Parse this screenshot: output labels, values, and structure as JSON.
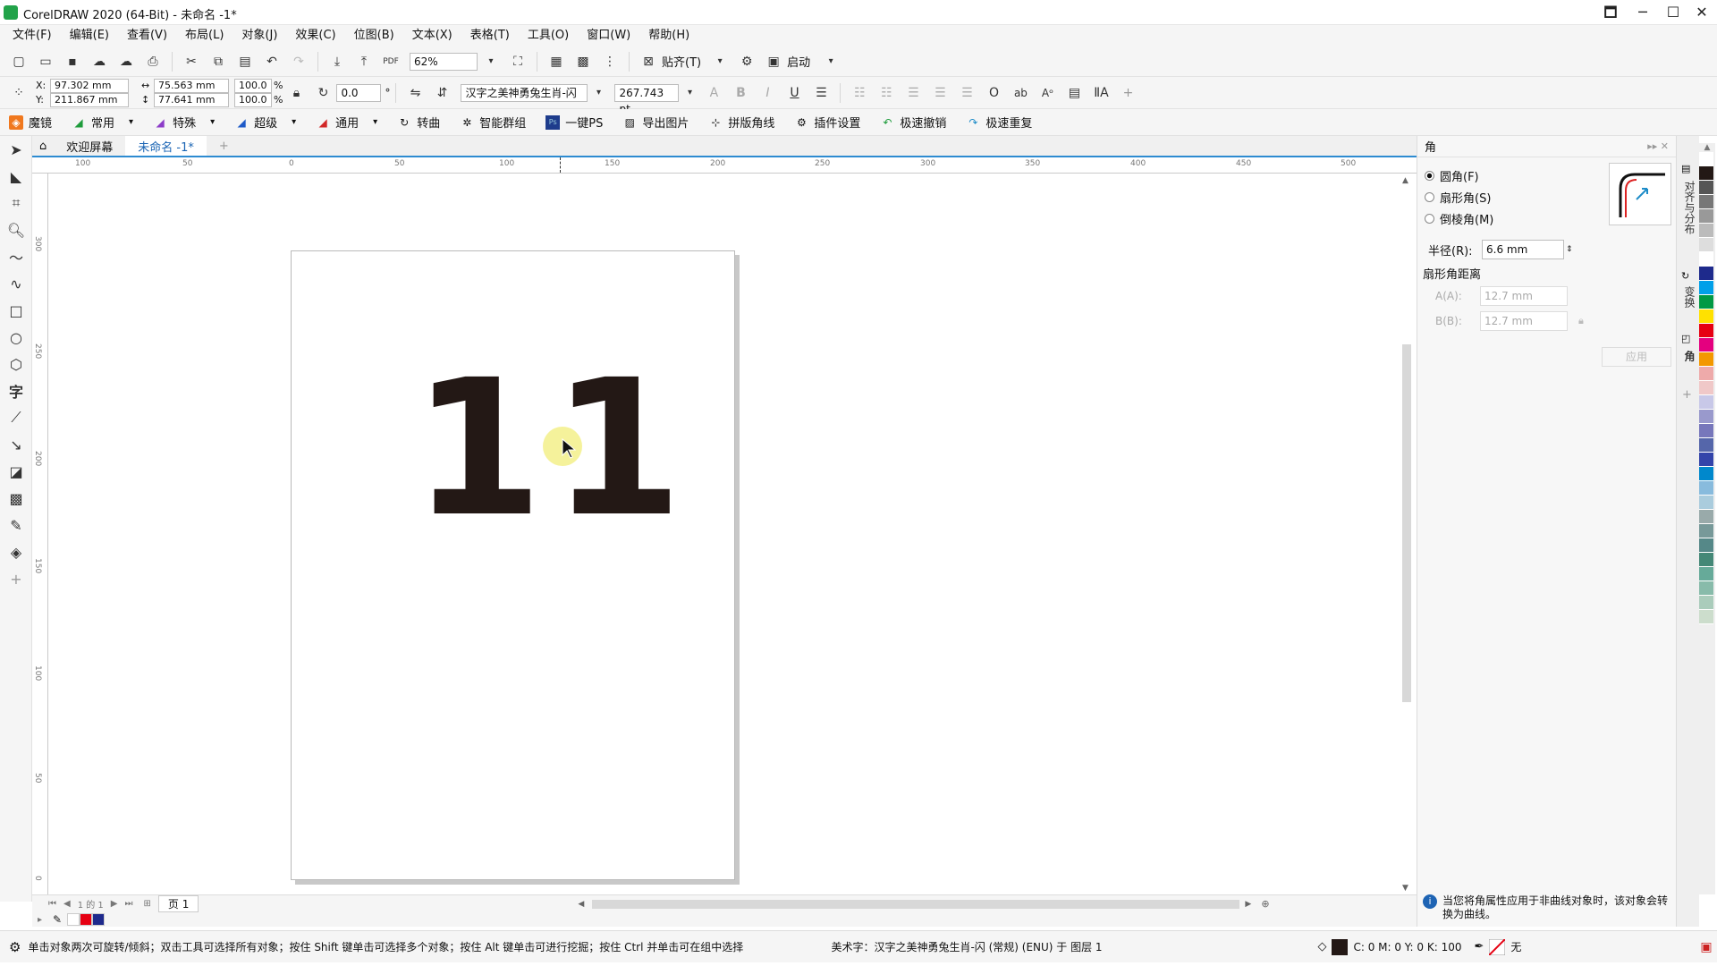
{
  "window": {
    "title": "CorelDRAW 2020 (64-Bit) - 未命名 -1*",
    "controls": [
      "🗖",
      "─",
      "☐",
      "✕"
    ]
  },
  "menu": [
    "文件(F)",
    "编辑(E)",
    "查看(V)",
    "布局(L)",
    "对象(J)",
    "效果(C)",
    "位图(B)",
    "文本(X)",
    "表格(T)",
    "工具(O)",
    "窗口(W)",
    "帮助(H)"
  ],
  "standard_toolbar": {
    "zoom": "62%",
    "snap_label": "贴齐(T)",
    "launch_label": "启动"
  },
  "property_bar": {
    "x": "97.302 mm",
    "y": "211.867 mm",
    "width": "75.563 mm",
    "height": "77.641 mm",
    "scale_x": "100.0",
    "scale_y": "100.0",
    "percent": "%",
    "rotation": "0.0",
    "degree": "°",
    "font_name": "汉字之美神勇兔生肖-闪",
    "font_size": "267.743 pt",
    "bold": "B",
    "italic": "I",
    "underline": "U"
  },
  "plugin_toolbar": [
    "魔镜",
    "常用",
    "特殊",
    "超级",
    "通用",
    "转曲",
    "智能群组",
    "一键PS",
    "导出图片",
    "拼版角线",
    "插件设置",
    "极速撤销",
    "极速重复"
  ],
  "doc_tabs": {
    "welcome": "欢迎屏幕",
    "active": "未命名 -1*",
    "add": "+"
  },
  "ruler": {
    "h_labels": [
      "100",
      "50",
      "0",
      "50",
      "100",
      "150",
      "200",
      "250",
      "300",
      "350",
      "400",
      "450",
      "500"
    ],
    "v_labels": [
      "300",
      "250",
      "200",
      "150",
      "100",
      "50",
      "0"
    ]
  },
  "canvas_text": "11",
  "page_nav": {
    "counter": "1 的 1",
    "page_tab": "页 1"
  },
  "docker": {
    "title": "角",
    "options": [
      "圆角(F)",
      "扇形角(S)",
      "倒棱角(M)"
    ],
    "selected_index": 0,
    "radius_label": "半径(R):",
    "radius_value": "6.6 mm",
    "section": "扇形角距离",
    "a_label": "A(A):",
    "a_value": "12.7 mm",
    "b_label": "B(B):",
    "b_value": "12.7 mm",
    "apply": "应用",
    "info": "当您将角属性应用于非曲线对象时，该对象会转换为曲线。",
    "side_tabs": [
      "对齐与分布",
      "变换",
      "角"
    ]
  },
  "status": {
    "hint": "单击对象两次可旋转/倾斜；双击工具可选择所有对象；按住 Shift 键单击可选择多个对象；按住 Alt 键单击可进行挖掘；按住 Ctrl 并单击可在组中选择",
    "object_info": "美术字：汉字之美神勇兔生肖-闪 (常规) (ENU) 于 图层 1",
    "fill_values": "C: 0 M: 0 Y: 0 K: 100",
    "outline": "无"
  },
  "colors": {
    "accent": "#2d8bd1",
    "glyph": "#231815",
    "cursor_highlight": "#f2ee7a"
  },
  "palette_colors": [
    "#ffffff",
    "#231815",
    "#555555",
    "#777777",
    "#999999",
    "#bbbbbb",
    "#dddddd",
    "#ffffff",
    "#1e2a8c",
    "#00a0e9",
    "#009944",
    "#ffe100",
    "#e60012",
    "#e4007f",
    "#f39800",
    "#eeaaaa",
    "#f0c8c8",
    "#c8c8e8",
    "#9999cc",
    "#7777bb",
    "#5566aa",
    "#3344aa",
    "#0088cc",
    "#88bbdd",
    "#aaccdd",
    "#99aaaa",
    "#779999",
    "#558888",
    "#448877",
    "#66aa99",
    "#88bbaa",
    "#aaccbb",
    "#ccddcc"
  ],
  "doc_palette": [
    "#ffffff",
    "#e60012",
    "#1e2a8c"
  ]
}
